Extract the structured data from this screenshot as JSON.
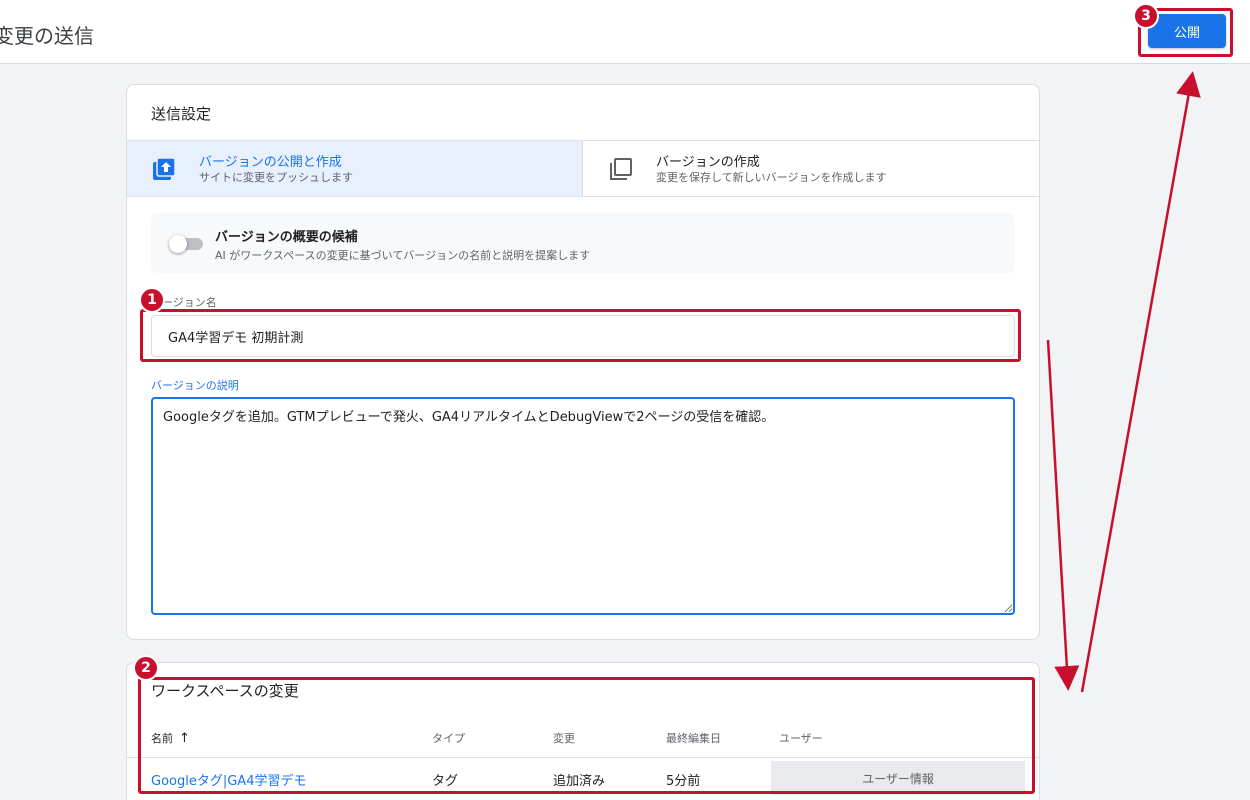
{
  "header": {
    "title": "変更の送信",
    "publish_label": "公開"
  },
  "settings": {
    "title": "送信設定",
    "modes": [
      {
        "label": "バージョンの公開と作成",
        "sub": "サイトに変更をプッシュします"
      },
      {
        "label": "バージョンの作成",
        "sub": "変更を保存して新しいバージョンを作成します"
      }
    ],
    "suggest": {
      "title": "バージョンの概要の候補",
      "desc": "AI がワークスペースの変更に基づいてバージョンの名前と説明を提案します"
    },
    "name_label": "バージョン名",
    "name_value": "GA4学習デモ 初期計測",
    "desc_label": "バージョンの説明",
    "desc_value": "Googleタグを追加。GTMプレビューで発火、GA4リアルタイムとDebugViewで2ページの受信を確認。"
  },
  "workspace": {
    "title": "ワークスペースの変更",
    "columns": [
      "名前",
      "タイプ",
      "変更",
      "最終編集日",
      "ユーザー"
    ],
    "sort_icon": "↑",
    "rows": [
      {
        "name": "Googleタグ|GA4学習デモ",
        "type": "タグ",
        "change": "追加済み",
        "date": "5分前",
        "user": "ユーザー情報"
      }
    ]
  },
  "annotations": [
    "1",
    "2",
    "3"
  ],
  "colors": {
    "accent": "#1a73e8",
    "highlight": "#c8102e"
  }
}
